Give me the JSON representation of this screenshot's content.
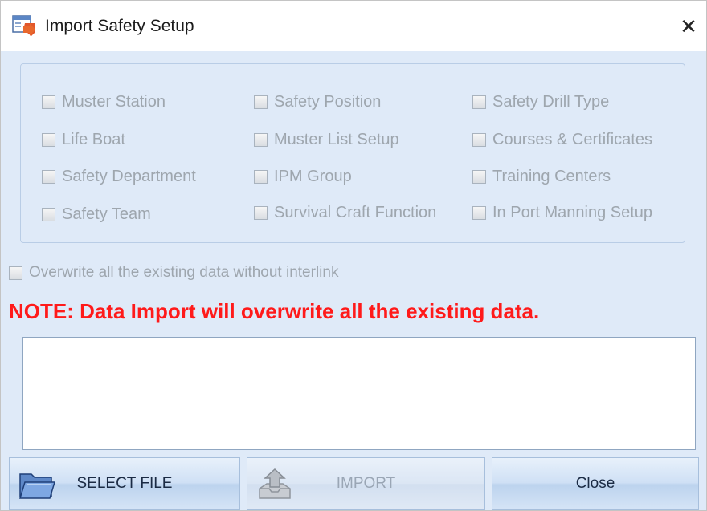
{
  "window": {
    "title": "Import Safety Setup",
    "close_glyph": "✕"
  },
  "options": [
    {
      "label": "Muster Station",
      "checked": false
    },
    {
      "label": "Safety Position",
      "checked": false
    },
    {
      "label": "Safety Drill Type",
      "checked": false
    },
    {
      "label": "Life Boat",
      "checked": false
    },
    {
      "label": "Muster List Setup",
      "checked": false
    },
    {
      "label": "Courses & Certificates",
      "checked": false
    },
    {
      "label": "Safety Department",
      "checked": false
    },
    {
      "label": "IPM Group",
      "checked": false
    },
    {
      "label": "Training Centers",
      "checked": false
    },
    {
      "label": "Safety Team",
      "checked": false
    },
    {
      "label": "Survival Craft Function",
      "checked": false
    },
    {
      "label": "In Port Manning Setup",
      "checked": false
    }
  ],
  "overwrite": {
    "label": "Overwrite all the existing data without interlink",
    "checked": false
  },
  "note": "NOTE:  Data Import will overwrite all the existing data.",
  "log": {
    "value": ""
  },
  "buttons": {
    "select_file": "SELECT FILE",
    "import": "IMPORT",
    "close": "Close"
  },
  "icons": {
    "title": "import-app-icon",
    "select_file": "folder-icon",
    "import": "import-tray-icon"
  },
  "colors": {
    "note": "#ff1a1a",
    "disabled_text": "#9ea6ae",
    "client_bg": "#dfeaf8"
  }
}
